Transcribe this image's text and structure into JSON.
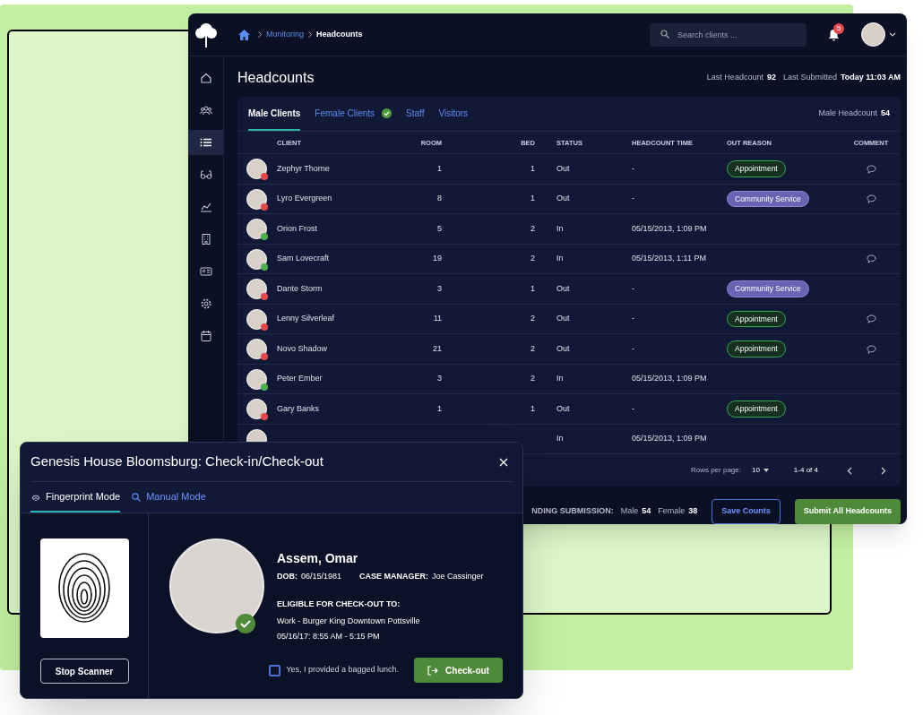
{
  "app": {
    "breadcrumbs": [
      {
        "label": "Monitoring",
        "link": true
      },
      {
        "label": "Headcounts",
        "link": false
      }
    ],
    "search": {
      "placeholder": "Search clients ..."
    },
    "notifications": "5",
    "sidebar": [
      {
        "selected": false
      },
      {
        "selected": false
      },
      {
        "selected": true
      },
      {
        "selected": false
      },
      {
        "selected": false
      },
      {
        "selected": false
      },
      {
        "selected": false
      },
      {
        "selected": false
      },
      {
        "selected": false
      }
    ],
    "title": "Headcounts",
    "last_headcount_label": "Last Headcount",
    "last_headcount": "92",
    "last_submitted_label": "Last Submitted",
    "last_submitted": "Today 11:03 AM",
    "tabs": [
      {
        "label": "Male Clients",
        "selected": true,
        "done": false
      },
      {
        "label": "Female Clients",
        "selected": false,
        "done": true
      },
      {
        "label": "Staff",
        "selected": false,
        "done": false
      },
      {
        "label": "Visitors",
        "selected": false,
        "done": false
      }
    ],
    "headcount_label": "Male Headcount",
    "headcount": "54",
    "columns": [
      "CLIENT",
      "ROOM",
      "BED",
      "STATUS",
      "HEADCOUNT TIME",
      "OUT REASON",
      "COMMENT"
    ],
    "rows": [
      {
        "name": "Zephyr Thorne",
        "room": "1",
        "bed": "1",
        "status": "Out",
        "time": "-",
        "reason": {
          "label": "Appointment",
          "kind": "appointment"
        },
        "comment": true,
        "color": "#e5484d"
      },
      {
        "name": "Lyro Evergreen",
        "room": "8",
        "bed": "1",
        "status": "Out",
        "time": "-",
        "reason": {
          "label": "Community Service",
          "kind": "service"
        },
        "comment": true,
        "color": "#e5484d"
      },
      {
        "name": "Orion Frost",
        "room": "5",
        "bed": "2",
        "status": "In",
        "time": "05/15/2013, 1:09 PM",
        "comment": false,
        "color": "#4caf50"
      },
      {
        "name": "Sam Lovecraft",
        "room": "19",
        "bed": "2",
        "status": "In",
        "time": "05/15/2013, 1:11 PM",
        "comment": true,
        "color": "#4caf50"
      },
      {
        "name": "Dante Storm",
        "room": "3",
        "bed": "1",
        "status": "Out",
        "time": "-",
        "reason": {
          "label": "Community Service",
          "kind": "service"
        },
        "comment": false,
        "color": "#e5484d"
      },
      {
        "name": "Lenny Silverleaf",
        "room": "11",
        "bed": "2",
        "status": "Out",
        "time": "-",
        "reason": {
          "label": "Appointment",
          "kind": "appointment"
        },
        "comment": true,
        "color": "#e5484d"
      },
      {
        "name": "Novo Shadow",
        "room": "21",
        "bed": "2",
        "status": "Out",
        "time": "-",
        "reason": {
          "label": "Appointment",
          "kind": "appointment"
        },
        "comment": true,
        "color": "#e5484d"
      },
      {
        "name": "Peter Ember",
        "room": "3",
        "bed": "2",
        "status": "In",
        "time": "05/15/2013, 1:09 PM",
        "comment": false,
        "color": "#4caf50"
      },
      {
        "name": "Gary Banks",
        "room": "1",
        "bed": "1",
        "status": "Out",
        "time": "-",
        "reason": {
          "label": "Appointment",
          "kind": "appointment"
        },
        "comment": false,
        "color": "#e5484d"
      },
      {
        "status": "In",
        "time": "05/15/2013, 1:09 PM",
        "comment": false
      }
    ],
    "rows_per_page_label": "Rows per page:",
    "rows_per_page": "10",
    "range": "1-4 of 4",
    "pending_label": "NDING SUBMISSION:",
    "male_label": "Male",
    "male": "54",
    "female_label": "Female",
    "female": "38",
    "save": "Save Counts",
    "submit": "Submit All Headcounts"
  },
  "dialog": {
    "title": "Genesis House Bloomsburg: Check-in/Check-out",
    "tabs": [
      {
        "label": "Fingerprint Mode",
        "selected": true
      },
      {
        "label": "Manual Mode",
        "selected": false
      }
    ],
    "stop": "Stop Scanner",
    "name": "Assem, Omar",
    "dob_label": "DOB:",
    "dob": "06/15/1981",
    "cm_label": "CASE MANAGER:",
    "cm": "Joe Cassinger",
    "verified": true,
    "eligible_label": "ELIGIBLE FOR CHECK-OUT TO:",
    "eligible": "Work - Burger King Downtown Pottsville",
    "eligible_time": "05/16/17: 8:55 AM - 5:15 PM",
    "lunch": {
      "label": "Yes, I provided a bagged lunch.",
      "checked": false
    },
    "action": "Check-out"
  }
}
